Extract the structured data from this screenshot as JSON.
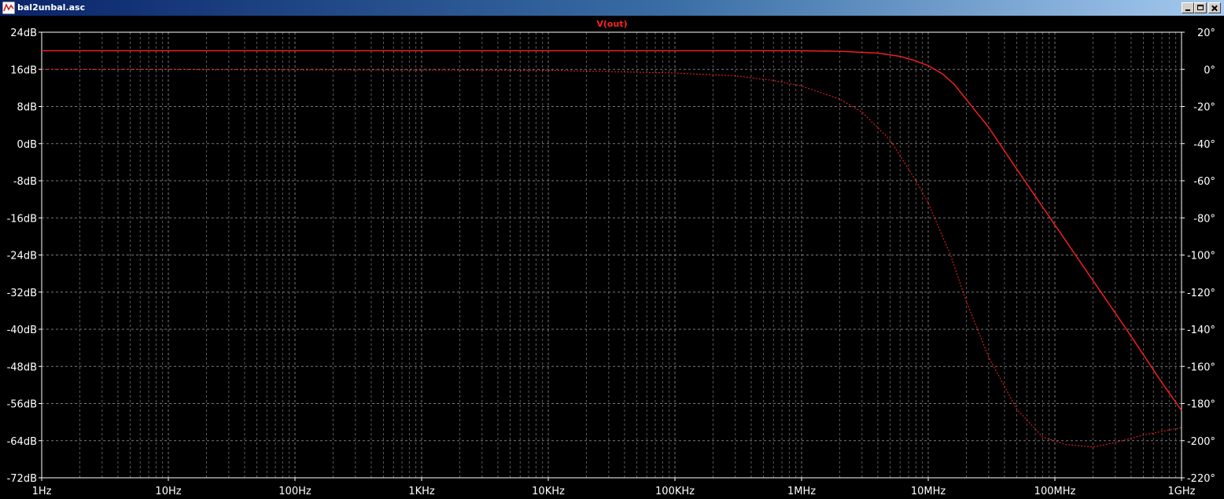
{
  "window": {
    "title": "bal2unbal.asc"
  },
  "colors": {
    "background": "#000000",
    "grid": "#7a7a7a",
    "axis_text": "#ffffff",
    "trace": "#ff2020"
  },
  "chart_data": {
    "type": "line",
    "title": "V(out)",
    "x_scale": "log",
    "xlim": [
      1,
      1000000000
    ],
    "x_ticks": [
      {
        "value": 1,
        "label": "1Hz"
      },
      {
        "value": 10,
        "label": "10Hz"
      },
      {
        "value": 100,
        "label": "100Hz"
      },
      {
        "value": 1000,
        "label": "1KHz"
      },
      {
        "value": 10000,
        "label": "10KHz"
      },
      {
        "value": 100000,
        "label": "100KHz"
      },
      {
        "value": 1000000,
        "label": "1MHz"
      },
      {
        "value": 10000000,
        "label": "10MHz"
      },
      {
        "value": 100000000,
        "label": "100MHz"
      },
      {
        "value": 1000000000,
        "label": "1GHz"
      }
    ],
    "y_left": {
      "unit": "dB",
      "ylim": [
        -72,
        24
      ],
      "ticks": [
        {
          "value": 24,
          "label": "24dB"
        },
        {
          "value": 16,
          "label": "16dB"
        },
        {
          "value": 8,
          "label": "8dB"
        },
        {
          "value": 0,
          "label": "0dB"
        },
        {
          "value": -8,
          "label": "-8dB"
        },
        {
          "value": -16,
          "label": "-16dB"
        },
        {
          "value": -24,
          "label": "-24dB"
        },
        {
          "value": -32,
          "label": "-32dB"
        },
        {
          "value": -40,
          "label": "-40dB"
        },
        {
          "value": -48,
          "label": "-48dB"
        },
        {
          "value": -56,
          "label": "-56dB"
        },
        {
          "value": -64,
          "label": "-64dB"
        },
        {
          "value": -72,
          "label": "-72dB"
        }
      ]
    },
    "y_right": {
      "unit": "°",
      "ylim": [
        -220,
        20
      ],
      "ticks": [
        {
          "value": 20,
          "label": "20°"
        },
        {
          "value": 0,
          "label": "0°"
        },
        {
          "value": -20,
          "label": "-20°"
        },
        {
          "value": -40,
          "label": "-40°"
        },
        {
          "value": -60,
          "label": "-60°"
        },
        {
          "value": -80,
          "label": "-80°"
        },
        {
          "value": -100,
          "label": "-100°"
        },
        {
          "value": -120,
          "label": "-120°"
        },
        {
          "value": -140,
          "label": "-140°"
        },
        {
          "value": -160,
          "label": "-160°"
        },
        {
          "value": -180,
          "label": "-180°"
        },
        {
          "value": -200,
          "label": "-200°"
        },
        {
          "value": -220,
          "label": "-220°"
        }
      ]
    },
    "grid": true,
    "series": [
      {
        "kind": "magnitude",
        "axis": "left",
        "style": "solid",
        "points": [
          [
            1,
            20.0
          ],
          [
            1000,
            20.0
          ],
          [
            100000,
            20.0
          ],
          [
            1000000,
            20.0
          ],
          [
            2000000,
            19.9
          ],
          [
            4000000,
            19.5
          ],
          [
            6000000,
            18.8
          ],
          [
            8000000,
            17.8
          ],
          [
            10000000,
            16.8
          ],
          [
            13000000,
            15.0
          ],
          [
            16000000,
            12.8
          ],
          [
            20000000,
            9.5
          ],
          [
            30000000,
            3.5
          ],
          [
            50000000,
            -5.5
          ],
          [
            100000000,
            -17.5
          ],
          [
            200000000,
            -29.5
          ],
          [
            400000000,
            -41.5
          ],
          [
            700000000,
            -51.5
          ],
          [
            1000000000,
            -57.5
          ]
        ]
      },
      {
        "kind": "phase",
        "axis": "right",
        "style": "dashed",
        "points": [
          [
            1,
            0
          ],
          [
            10000,
            -0.5
          ],
          [
            100000,
            -2
          ],
          [
            300000,
            -3.5
          ],
          [
            600000,
            -6
          ],
          [
            1000000,
            -9
          ],
          [
            2000000,
            -16
          ],
          [
            3000000,
            -23
          ],
          [
            5000000,
            -38
          ],
          [
            8000000,
            -60
          ],
          [
            10000000,
            -72
          ],
          [
            15000000,
            -100
          ],
          [
            20000000,
            -125
          ],
          [
            30000000,
            -155
          ],
          [
            50000000,
            -183
          ],
          [
            80000000,
            -198
          ],
          [
            120000000,
            -202
          ],
          [
            200000000,
            -203.5
          ],
          [
            300000000,
            -201
          ],
          [
            500000000,
            -197
          ],
          [
            1000000000,
            -193
          ]
        ]
      }
    ]
  }
}
